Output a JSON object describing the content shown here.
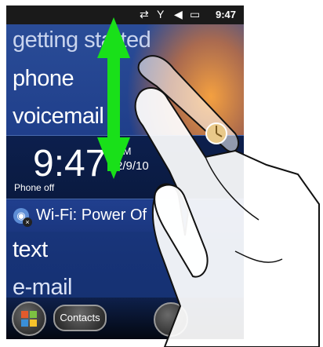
{
  "status_bar": {
    "time": "9:47",
    "icons": [
      "sync-icon",
      "no-signal-icon",
      "speaker-muted-icon",
      "battery-charging-icon"
    ]
  },
  "menu": {
    "items": [
      "getting started",
      "phone",
      "voicemail"
    ]
  },
  "clock": {
    "time": "9:47",
    "ampm": "AM",
    "date": "2/9/10",
    "phone_status": "Phone off"
  },
  "wifi": {
    "label": "Wi-Fi: Power Of",
    "icon": "wifi-off-icon"
  },
  "lower_menu": {
    "items": [
      "text",
      "e-mail"
    ]
  },
  "taskbar": {
    "start_icon": "windows-flag-icon",
    "contacts_label": "Contacts"
  },
  "gesture": {
    "type": "vertical-swipe",
    "arrow_color": "#19e019"
  },
  "colors": {
    "screen_bg": "#1f3e8a",
    "status_bar_bg": "#1a1a1a",
    "arrow": "#19e019"
  }
}
